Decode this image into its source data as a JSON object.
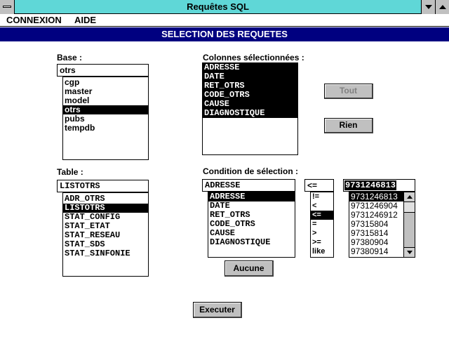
{
  "window": {
    "title": "Requêtes SQL"
  },
  "menu": {
    "items": [
      "CONNEXION",
      "AIDE"
    ]
  },
  "banner": {
    "title": "SELECTION DES REQUETES"
  },
  "base": {
    "label": "Base :",
    "value": "otrs",
    "options": [
      "cgp",
      "master",
      "model",
      "otrs",
      "pubs",
      "tempdb"
    ],
    "selected": "otrs"
  },
  "table": {
    "label": "Table :",
    "value": "LISTOTRS",
    "options": [
      "ADR_OTRS",
      "LISTOTRS",
      "STAT_CONFIG",
      "STAT_ETAT",
      "STAT_RESEAU",
      "STAT_SDS",
      "STAT_SINFONIE"
    ],
    "selected": "LISTOTRS"
  },
  "columns": {
    "label": "Colonnes sélectionnées :",
    "items": [
      "ADRESSE",
      "DATE",
      "RET_OTRS",
      "CODE_OTRS",
      "CAUSE",
      "DIAGNOSTIQUE"
    ]
  },
  "buttons": {
    "tout": "Tout",
    "rien": "Rien",
    "aucune": "Aucune",
    "executer": "Executer"
  },
  "condition": {
    "label": "Condition de sélection :",
    "field_value": "ADRESSE",
    "field_options": [
      "ADRESSE",
      "DATE",
      "RET_OTRS",
      "CODE_OTRS",
      "CAUSE",
      "DIAGNOSTIQUE"
    ],
    "field_selected": "ADRESSE",
    "operator_value": "<=",
    "operator_options": [
      "!=",
      "<",
      "<=",
      "=",
      ">",
      ">=",
      "like"
    ],
    "operator_selected": "<=",
    "value_value": "9731246813",
    "value_options": [
      "9731246813",
      "9731246904",
      "9731246912",
      "97315804",
      "97315814",
      "97380904",
      "97380914"
    ],
    "value_selected": "9731246813"
  },
  "icons": {
    "system_menu": "system-menu-icon",
    "minimize": "minimize-arrow-icon",
    "maximize": "maximize-arrow-icon",
    "scroll_up": "scroll-up-arrow-icon",
    "scroll_down": "scroll-down-arrow-icon"
  },
  "colors": {
    "titlebar": "#5fd7d7",
    "banner": "#000080",
    "button_face": "#c0c0c0",
    "selection": "#000000"
  }
}
